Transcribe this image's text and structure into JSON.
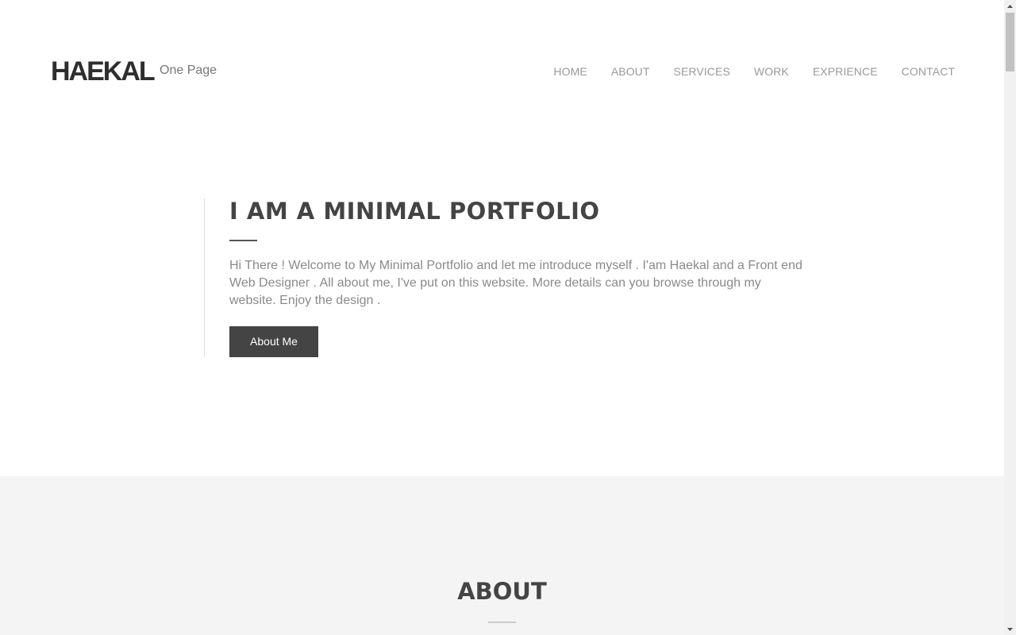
{
  "header": {
    "logo": "HAEKAL",
    "tagline": "One Page",
    "nav": [
      "HOME",
      "ABOUT",
      "SERVICES",
      "WORK",
      "EXPRIENCE",
      "CONTACT"
    ]
  },
  "hero": {
    "title": "I AM A MINIMAL PORTFOLIO",
    "text": "Hi There ! Welcome to My Minimal Portfolio and let me introduce myself . I'am Haekal and a Front end Web Designer . All about me, I've put on this website. More details can you browse through my website. Enjoy the design .",
    "button_label": "About Me"
  },
  "about": {
    "title": "ABOUT"
  },
  "colors": {
    "accent": "#444444",
    "section_bg": "#f4f4f4"
  },
  "icons": {
    "scroll_up": "triangle-up-icon",
    "scroll_down": "triangle-down-icon"
  }
}
